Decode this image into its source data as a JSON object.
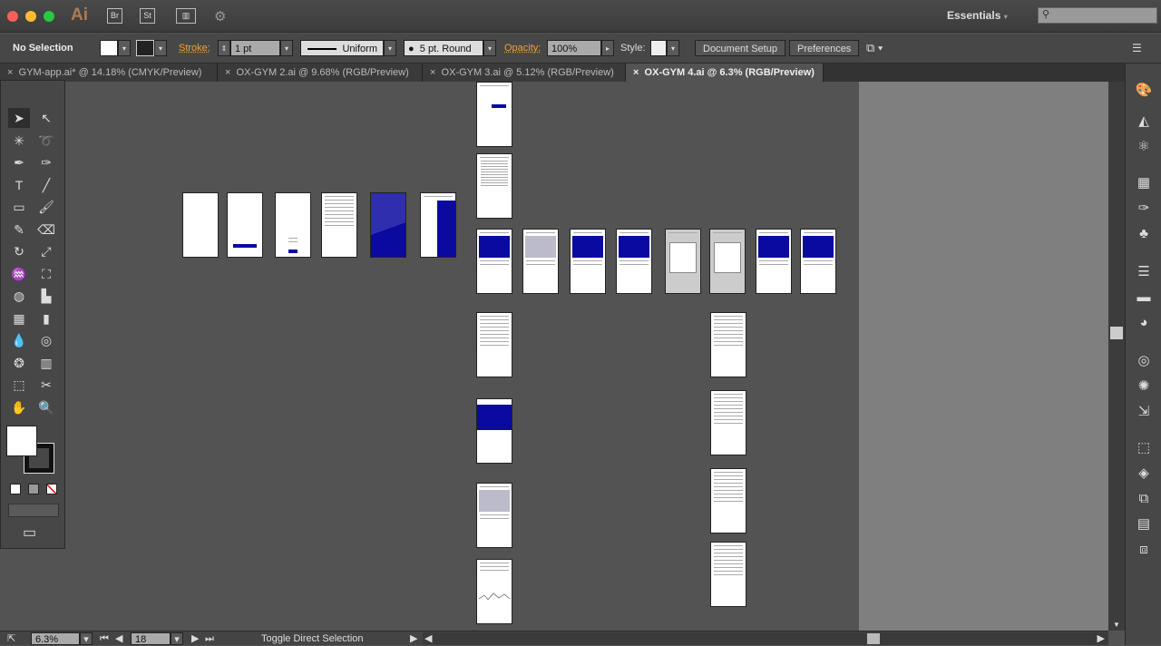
{
  "app": {
    "logo": "Ai",
    "bridge": "Br",
    "stock": "St",
    "workspace": "Essentials",
    "search_placeholder": ""
  },
  "control": {
    "selection": "No Selection",
    "stroke_label": "Stroke:",
    "stroke_value": "1 pt",
    "profile": "Uniform",
    "brush": "5 pt. Round",
    "opacity_label": "Opacity:",
    "opacity_value": "100%",
    "style_label": "Style:",
    "document_setup": "Document Setup",
    "preferences": "Preferences"
  },
  "tabs": [
    {
      "label": "GYM-app.ai* @ 14.18% (CMYK/Preview)"
    },
    {
      "label": "OX-GYM 2.ai @ 9.68% (RGB/Preview)"
    },
    {
      "label": "OX-GYM 3.ai @ 5.12% (RGB/Preview)"
    },
    {
      "label": "OX-GYM 4.ai @ 6.3% (RGB/Preview)"
    }
  ],
  "status": {
    "zoom": "6.3%",
    "artboard": "18",
    "tool_status": "Toggle Direct Selection"
  },
  "colors": {
    "accent": "#0a0aa0",
    "canvas": "#535353"
  }
}
